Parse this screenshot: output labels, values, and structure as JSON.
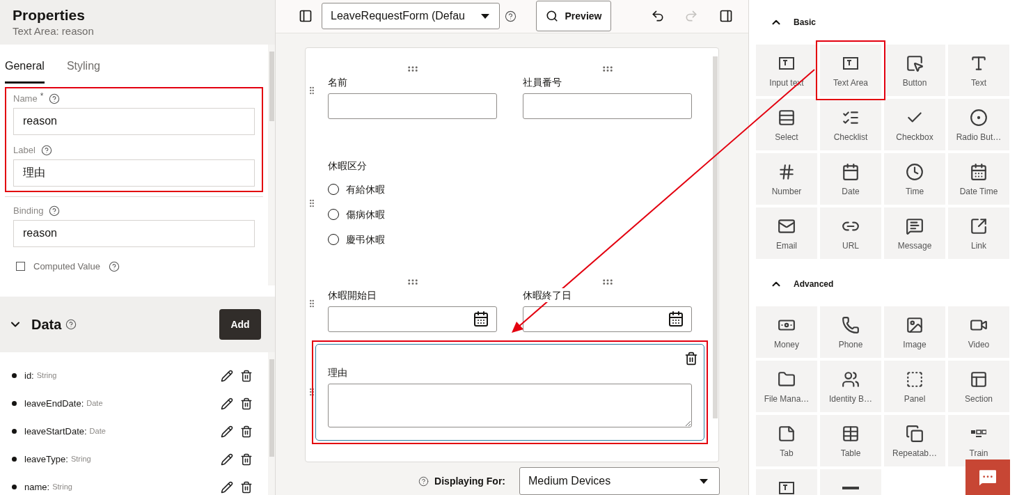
{
  "properties": {
    "title": "Properties",
    "subtitle": "Text Area: reason"
  },
  "required_symbol": "*",
  "tabs": [
    {
      "label": "General",
      "selected": true
    },
    {
      "label": "Styling",
      "selected": false
    }
  ],
  "fields": [
    {
      "label": "Name",
      "required": true,
      "value": "reason",
      "highlighted": true
    },
    {
      "label": "Label",
      "required": false,
      "value": "理由",
      "highlighted": true
    },
    {
      "label": "Binding",
      "required": false,
      "value": "reason",
      "highlighted": false
    }
  ],
  "computed": {
    "label": "Computed Value",
    "checked": false
  },
  "data_section": {
    "title": "Data",
    "expanded": true,
    "add_button": "Add",
    "items": [
      {
        "name": "id:",
        "type": "String"
      },
      {
        "name": "leaveEndDate:",
        "type": "Date"
      },
      {
        "name": "leaveStartDate:",
        "type": "Date"
      },
      {
        "name": "leaveType:",
        "type": "String"
      },
      {
        "name": "name:",
        "type": "String"
      }
    ]
  },
  "toolbar": {
    "form_select": "LeaveRequestForm (Defau",
    "preview": "Preview",
    "redo_disabled": true
  },
  "form": {
    "rows": [
      {
        "selected": false,
        "highlighted": false,
        "fields": [
          {
            "kind": "text",
            "label": "名前"
          },
          {
            "kind": "text",
            "label": "社員番号"
          }
        ]
      },
      {
        "selected": false,
        "highlighted": false,
        "fields": [
          {
            "kind": "radio",
            "label": "休暇区分",
            "options": [
              {
                "label": "有給休暇",
                "selected": false
              },
              {
                "label": "傷病休暇",
                "selected": false
              },
              {
                "label": "慶弔休暇",
                "selected": false
              }
            ]
          }
        ]
      },
      {
        "selected": false,
        "highlighted": false,
        "fields": [
          {
            "kind": "date",
            "label": "休暇開始日"
          },
          {
            "kind": "date",
            "label": "休暇終了日"
          }
        ]
      },
      {
        "selected": true,
        "highlighted": true,
        "fields": [
          {
            "kind": "textarea",
            "label": "理由"
          }
        ]
      }
    ]
  },
  "displaying_for": {
    "label": "Displaying For:",
    "value": "Medium Devices"
  },
  "palette": [
    {
      "title": "Basic",
      "expanded": true,
      "items": [
        {
          "label": "Input text",
          "kind": "textbox",
          "highlighted": false
        },
        {
          "label": "Text Area",
          "kind": "textarea",
          "highlighted": true
        },
        {
          "label": "Button",
          "kind": "button",
          "highlighted": false
        },
        {
          "label": "Text",
          "kind": "text",
          "highlighted": false
        },
        {
          "label": "Select",
          "kind": "select",
          "highlighted": false
        },
        {
          "label": "Checklist",
          "kind": "checklist",
          "highlighted": false
        },
        {
          "label": "Checkbox",
          "kind": "checkbox",
          "highlighted": false
        },
        {
          "label": "Radio But…",
          "kind": "radio",
          "highlighted": false
        },
        {
          "label": "Number",
          "kind": "number",
          "highlighted": false
        },
        {
          "label": "Date",
          "kind": "date",
          "highlighted": false
        },
        {
          "label": "Time",
          "kind": "time",
          "highlighted": false
        },
        {
          "label": "Date Time",
          "kind": "datetime",
          "highlighted": false
        },
        {
          "label": "Email",
          "kind": "email",
          "highlighted": false
        },
        {
          "label": "URL",
          "kind": "url",
          "highlighted": false
        },
        {
          "label": "Message",
          "kind": "message",
          "highlighted": false
        },
        {
          "label": "Link",
          "kind": "link",
          "highlighted": false
        }
      ]
    },
    {
      "title": "Advanced",
      "expanded": true,
      "items": [
        {
          "label": "Money",
          "kind": "money",
          "highlighted": false
        },
        {
          "label": "Phone",
          "kind": "phone",
          "highlighted": false
        },
        {
          "label": "Image",
          "kind": "image",
          "highlighted": false
        },
        {
          "label": "Video",
          "kind": "video",
          "highlighted": false
        },
        {
          "label": "File Mana…",
          "kind": "folder",
          "highlighted": false
        },
        {
          "label": "Identity B…",
          "kind": "users",
          "highlighted": false
        },
        {
          "label": "Panel",
          "kind": "panel",
          "highlighted": false
        },
        {
          "label": "Section",
          "kind": "section",
          "highlighted": false
        },
        {
          "label": "Tab",
          "kind": "tab",
          "highlighted": false
        },
        {
          "label": "Table",
          "kind": "table",
          "highlighted": false
        },
        {
          "label": "Repeatab…",
          "kind": "repeat",
          "highlighted": false
        },
        {
          "label": "Train",
          "kind": "train",
          "highlighted": false
        },
        {
          "kind": "textbox",
          "highlighted": false
        },
        {
          "kind": "divider",
          "highlighted": false
        }
      ]
    }
  ]
}
